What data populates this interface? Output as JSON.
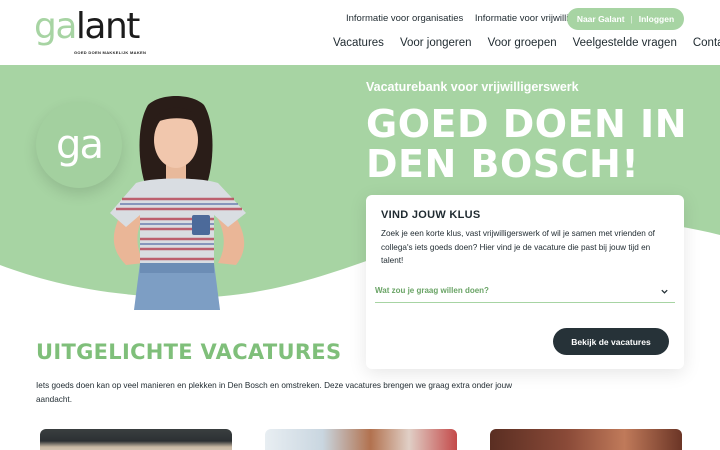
{
  "brand": {
    "logo_ga": "ga",
    "logo_lant": "lant",
    "tagline": "GOED DOEN MAKKELIJK MAKEN",
    "badge_text": "ga",
    "accent": "#a7d4a3",
    "dark": "#263238"
  },
  "top_links": [
    "Informatie voor organisaties",
    "Informatie voor vrijwilligers"
  ],
  "account": {
    "primary": "Naar Galant",
    "separator": "|",
    "secondary": "Inloggen"
  },
  "nav": [
    "Vacatures",
    "Voor jongeren",
    "Voor groepen",
    "Veelgestelde vragen",
    "Contact"
  ],
  "hero": {
    "kicker": "Vacaturebank voor vrijwilligerswerk",
    "title_line1": "GOED DOEN IN",
    "title_line2": "DEN BOSCH!"
  },
  "search": {
    "title": "VIND JOUW KLUS",
    "text": "Zoek je een korte klus, vast vrijwilligerswerk of wil je samen met vrienden of collega's iets goeds doen? Hier vind je de vacature die past bij jouw tijd en talent!",
    "select_label": "Wat zou je graag willen doen?",
    "button": "Bekijk de vacatures"
  },
  "featured": {
    "title": "UITGELICHTE VACATURES",
    "text": "Iets goeds doen kan op veel manieren en plekken in Den Bosch en omstreken. Deze vacatures brengen we graag extra onder jouw aandacht."
  }
}
